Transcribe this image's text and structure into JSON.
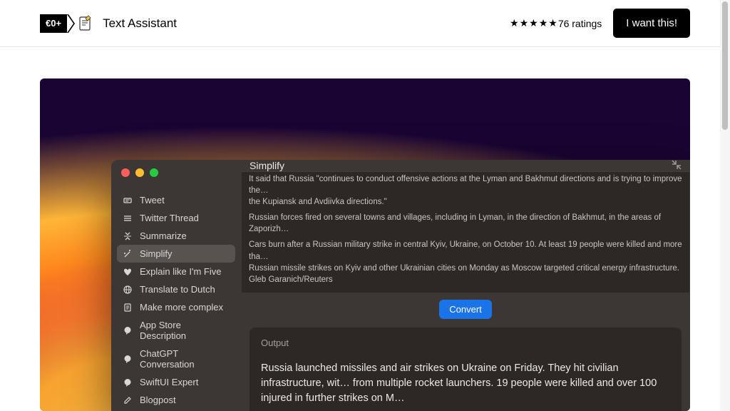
{
  "header": {
    "price": "€0+",
    "title": "Text Assistant",
    "ratings_count": "76 ratings",
    "buy_label": "I want this!"
  },
  "sidebar": {
    "items": [
      {
        "label": "Tweet",
        "icon": "tag"
      },
      {
        "label": "Twitter Thread",
        "icon": "list"
      },
      {
        "label": "Summarize",
        "icon": "collapse"
      },
      {
        "label": "Simplify",
        "icon": "wand",
        "selected": true
      },
      {
        "label": "Explain like I'm Five",
        "icon": "heart"
      },
      {
        "label": "Translate to Dutch",
        "icon": "globe"
      },
      {
        "label": "Make more complex",
        "icon": "doc"
      },
      {
        "label": "App Store Description",
        "icon": "chat"
      },
      {
        "label": "ChatGPT Conversation",
        "icon": "chat"
      },
      {
        "label": "SwiftUI Expert",
        "icon": "chat"
      },
      {
        "label": "Blogpost",
        "icon": "pencil"
      }
    ]
  },
  "main": {
    "title": "Simplify",
    "input_lines": [
      "It said that Russia \"continues to conduct offensive actions at the Lyman and Bakhmut directions and is trying to improve the…",
      "the Kupiansk and Avdiivka directions.\"",
      "",
      "Russian forces fired on several towns and villages, including in Lyman, in the direction of Bakhmut, in the areas of Zaporizh…",
      "",
      "Cars burn after a Russian military strike in central Kyiv, Ukraine, on October 10. At least 19 people were killed and more tha…",
      "Russian missile strikes on Kyiv and other Ukrainian cities on Monday as Moscow targeted critical energy infrastructure.",
      "Gleb Garanich/Reuters"
    ],
    "convert_label": "Convert",
    "output_label": "Output",
    "output_text": "Russia launched missiles and air strikes on Ukraine on Friday. They hit civilian infrastructure, wit… from multiple rocket launchers. 19 people were killed and over 100 injured in further strikes on M…"
  }
}
